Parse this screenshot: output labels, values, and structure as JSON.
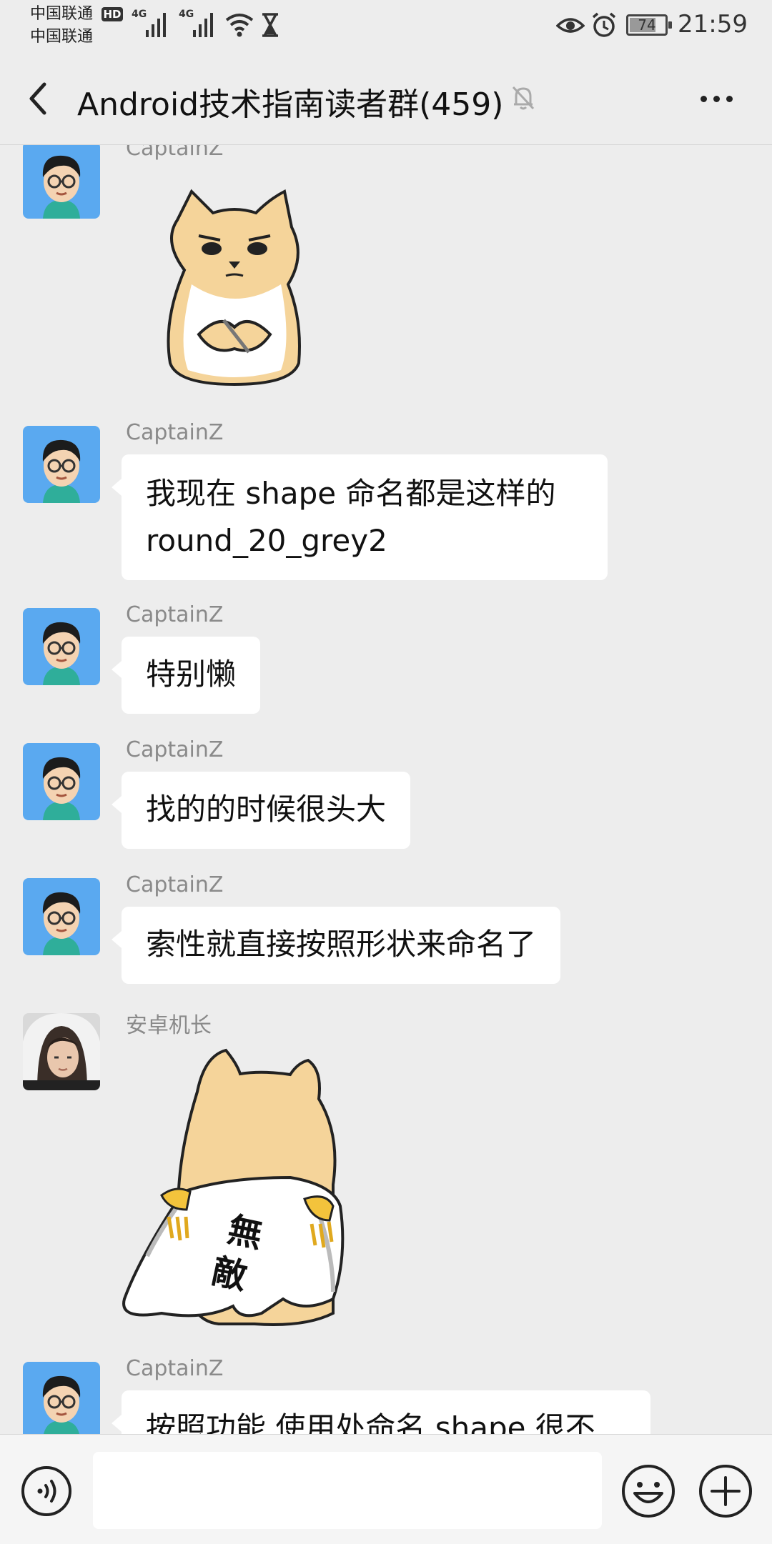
{
  "status_bar": {
    "carrier_1": "中国联通",
    "carrier_2": "中国联通",
    "hd_badge": "HD",
    "network_1": "4G",
    "network_2": "4G",
    "battery_level": "74",
    "battery_fraction": 0.74,
    "time": "21:59"
  },
  "header": {
    "back_icon": "chevron-left-icon",
    "title": "Android技术指南读者群(459)",
    "mute_icon": "bell-off-icon",
    "more_icon": "more-dots-icon"
  },
  "messages": [
    {
      "sender": "CaptainZ",
      "type": "sticker",
      "sticker": "shiba-dog-sticker",
      "avatar": "cartoon-avatar"
    },
    {
      "sender": "CaptainZ",
      "type": "text",
      "text": "我现在 shape 命名都是这样的\nround_20_grey2",
      "avatar": "cartoon-avatar"
    },
    {
      "sender": "CaptainZ",
      "type": "text",
      "text": "特别懒",
      "avatar": "cartoon-avatar"
    },
    {
      "sender": "CaptainZ",
      "type": "text",
      "text": "找的的时候很头大",
      "avatar": "cartoon-avatar"
    },
    {
      "sender": "CaptainZ",
      "type": "text",
      "text": "索性就直接按照形状来命名了",
      "avatar": "cartoon-avatar"
    },
    {
      "sender": "安卓机长",
      "type": "sticker",
      "sticker": "invincible-cape-dog-sticker",
      "sticker_text": [
        "無",
        "敵"
      ],
      "avatar": "photo-avatar"
    },
    {
      "sender": "CaptainZ",
      "type": "text",
      "text": "按照功能 使用处命名 shape 很不",
      "avatar": "cartoon-avatar"
    }
  ],
  "input_bar": {
    "voice_icon": "voice-icon",
    "input_value": "",
    "emoji_icon": "emoji-icon",
    "plus_icon": "plus-icon"
  },
  "colors": {
    "background": "#ededed",
    "bubble": "#ffffff",
    "sender_name": "#8a8a8a",
    "avatar_blue": "#5aa9f0"
  }
}
